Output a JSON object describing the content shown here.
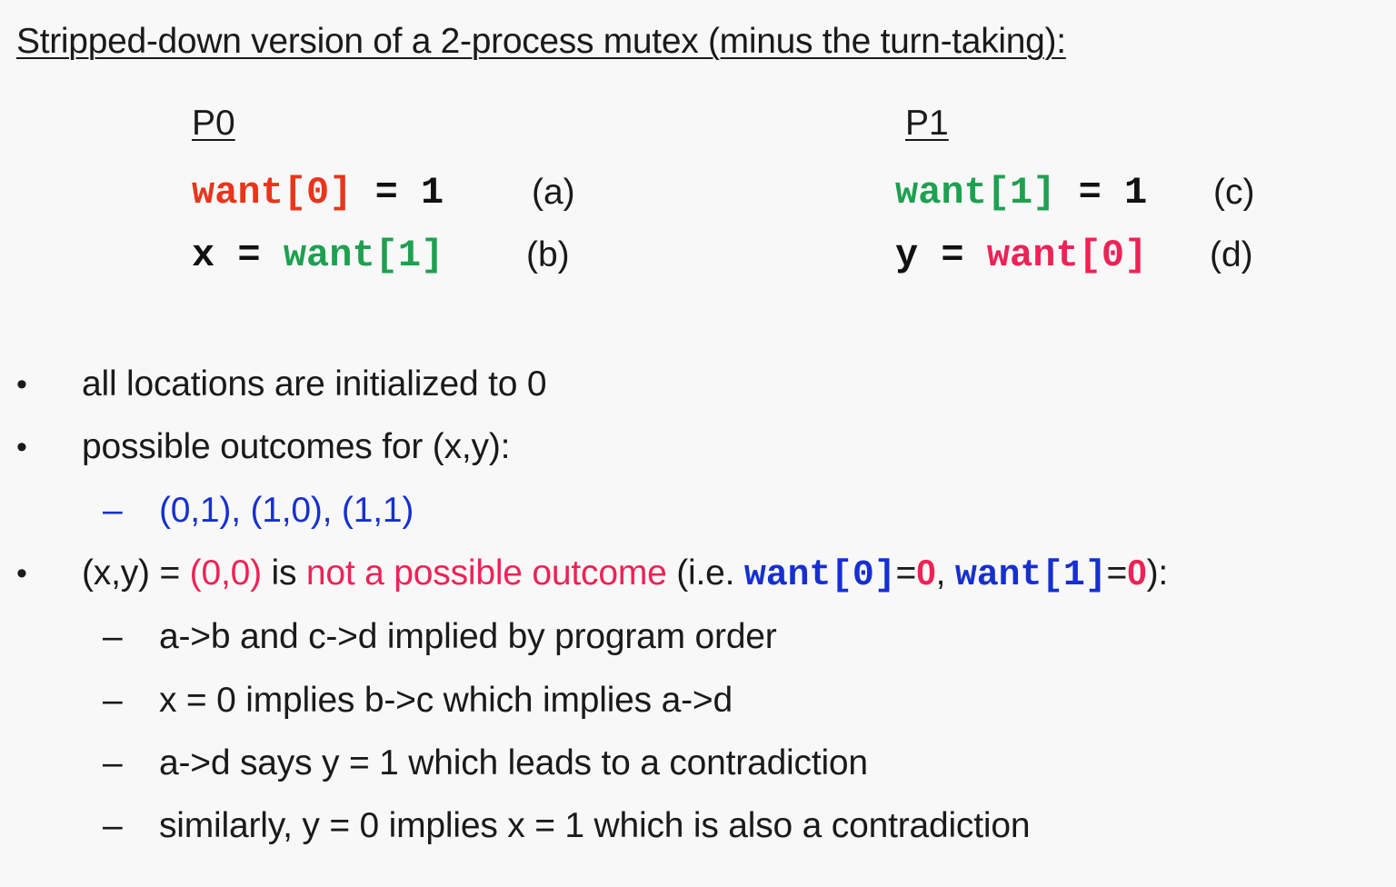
{
  "title": "Stripped-down version of a 2-process mutex (minus the turn-taking):",
  "processes": {
    "p0": {
      "heading": "P0",
      "line1": {
        "lhs": "want[0]",
        "op": " = 1",
        "label": "(a)"
      },
      "line2": {
        "lhs": "x",
        "op": " = ",
        "rhs": "want[1]",
        "label": "(b)"
      }
    },
    "p1": {
      "heading": "P1",
      "line1": {
        "lhs": "want[1]",
        "op": " = 1",
        "label": "(c)"
      },
      "line2": {
        "lhs": "y",
        "op": " = ",
        "rhs": "want[0]",
        "label": "(d)"
      }
    }
  },
  "bullets": {
    "b1": "all locations are initialized to 0",
    "b2": "possible outcomes for (x,y):",
    "b2_sub": "(0,1), (1,0), (1,1)",
    "b3": {
      "prefix": "(x,y) = ",
      "pair": "(0,0)",
      "is": " is ",
      "not_possible": "not a possible outcome",
      "ie": " (i.e. ",
      "w0": "want[0]",
      "eq1": "=",
      "zero1": "0",
      "comma": ", ",
      "w1": "want[1]",
      "eq2": "=",
      "zero2": "0",
      "end": "):"
    },
    "b3_subs": [
      "a->b and c->d implied by program order",
      "x = 0 implies b->c which implies a->d",
      "a->d says y = 1 which leads to a contradiction",
      "similarly, y = 0 implies x = 1 which is also a contradiction"
    ]
  },
  "symbols": {
    "bullet": "•",
    "dash": "–"
  },
  "colors": {
    "red": "#e8351c",
    "green": "#1fa050",
    "pink": "#ee2256",
    "blue": "#1630d0",
    "background": "#f8f8f8"
  }
}
